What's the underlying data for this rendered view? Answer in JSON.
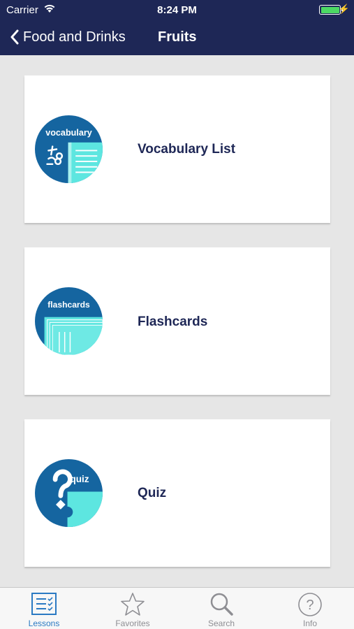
{
  "status_bar": {
    "carrier": "Carrier",
    "time": "8:24 PM"
  },
  "nav": {
    "back_label": "Food and Drinks",
    "title": "Fruits"
  },
  "cards": [
    {
      "label": "Vocabulary List",
      "icon": "vocabulary-icon",
      "icon_text": "vocabulary"
    },
    {
      "label": "Flashcards",
      "icon": "flashcards-icon",
      "icon_text": "flashcards"
    },
    {
      "label": "Quiz",
      "icon": "quiz-icon",
      "icon_text": "quiz"
    }
  ],
  "tabs": [
    {
      "label": "Lessons",
      "icon": "lessons-icon",
      "active": true
    },
    {
      "label": "Favorites",
      "icon": "star-icon",
      "active": false
    },
    {
      "label": "Search",
      "icon": "search-icon",
      "active": false
    },
    {
      "label": "Info",
      "icon": "info-icon",
      "active": false
    }
  ],
  "colors": {
    "header": "#1e2756",
    "icon_navy": "#1565a0",
    "icon_teal": "#5de6e0",
    "accent": "#2b7ac3",
    "background": "#e6e6e6"
  }
}
